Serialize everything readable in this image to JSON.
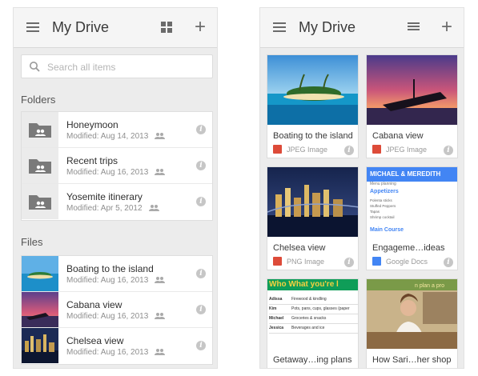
{
  "left_screen": {
    "title": "My Drive",
    "search_placeholder": "Search all items",
    "folders_header": "Folders",
    "folders": [
      {
        "name": "Honeymoon",
        "modified": "Modified: Aug 14, 2013"
      },
      {
        "name": "Recent trips",
        "modified": "Modified: Aug 16, 2013"
      },
      {
        "name": "Yosemite itinerary",
        "modified": "Modified: Apr 5, 2012"
      }
    ],
    "files_header": "Files",
    "files": [
      {
        "name": "Boating to the island",
        "modified": "Modified: Aug 16, 2013"
      },
      {
        "name": "Cabana view",
        "modified": "Modified: Aug 16, 2013"
      },
      {
        "name": "Chelsea view",
        "modified": "Modified: Aug 16, 2013"
      }
    ]
  },
  "right_screen": {
    "title": "My Drive",
    "cards": [
      {
        "name": "Boating to the island",
        "type": "JPEG Image",
        "icon": "image-icon"
      },
      {
        "name": "Cabana view",
        "type": "JPEG Image",
        "icon": "image-icon"
      },
      {
        "name": "Chelsea view",
        "type": "PNG Image",
        "icon": "image-icon"
      },
      {
        "name": "Engageme…ideas",
        "type": "Google Docs",
        "icon": "docs-icon"
      },
      {
        "name": "Getaway…ing plans",
        "type": "",
        "icon": ""
      },
      {
        "name": "How Sari…her shop",
        "type": "",
        "icon": ""
      }
    ],
    "menu_preview": {
      "heading": "MICHAEL & MEREDITH",
      "sub": "Menu planning",
      "appetizers": "Appetizers",
      "items": [
        "Polenta sticks",
        "Stuffed Peppers",
        "Tapas",
        "Shrimp cocktail"
      ],
      "main_course": "Main Course"
    },
    "sheet_preview": {
      "header": "Who What you're l",
      "tag": "n plan a pro",
      "rows": [
        {
          "who": "Adissa",
          "what": "Firewood & kindling"
        },
        {
          "who": "Kim",
          "what": "Pots, pans, cups, glasses (paper"
        },
        {
          "who": "Michael",
          "what": "Groceries & snacks"
        },
        {
          "who": "Jessica",
          "what": "Beverages and ice"
        }
      ]
    }
  },
  "colors": {
    "accent_blue": "#4285f4",
    "image_red": "#dd4b39",
    "sheet_green": "#0f9d58",
    "sheet_yellow": "#f4d03f"
  }
}
